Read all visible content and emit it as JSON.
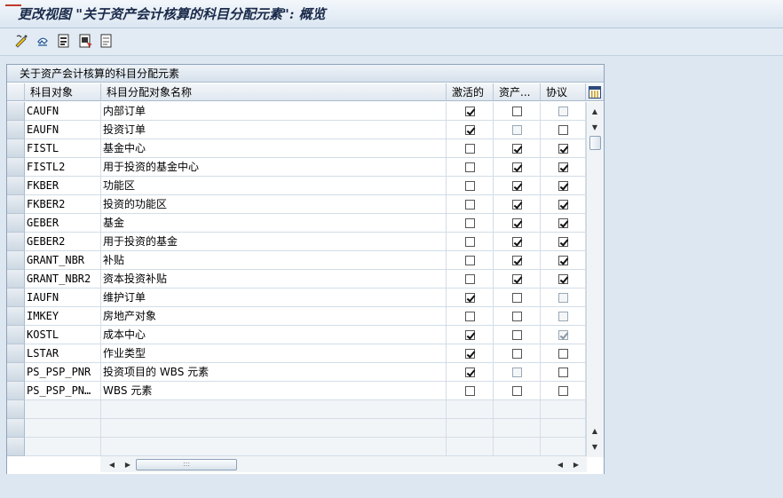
{
  "window": {
    "title": "更改视图 \"关于资产会计核算的科目分配元素\": 概览"
  },
  "toolbar": {
    "buttons": [
      {
        "name": "change-display-icon",
        "tooltip": ""
      },
      {
        "name": "undo-icon",
        "tooltip": ""
      },
      {
        "name": "select-all-icon",
        "tooltip": ""
      },
      {
        "name": "select-block-icon",
        "tooltip": ""
      },
      {
        "name": "deselect-all-icon",
        "tooltip": ""
      }
    ]
  },
  "table": {
    "title": "关于资产会计核算的科目分配元素",
    "columns": [
      "科目对象",
      "科目分配对象名称",
      "激活的",
      "资产...",
      "协议"
    ],
    "rows": [
      {
        "obj": "CAUFN",
        "name": "内部订单",
        "active": true,
        "asset": false,
        "agree": false,
        "agree_disabled": true,
        "asset_disabled": false
      },
      {
        "obj": "EAUFN",
        "name": "投资订单",
        "active": true,
        "asset": false,
        "agree": false,
        "agree_disabled": false,
        "asset_disabled": true
      },
      {
        "obj": "FISTL",
        "name": "基金中心",
        "active": false,
        "asset": true,
        "agree": true,
        "agree_disabled": false,
        "asset_disabled": false
      },
      {
        "obj": "FISTL2",
        "name": "用于投资的基金中心",
        "active": false,
        "asset": true,
        "agree": true,
        "agree_disabled": false,
        "asset_disabled": false
      },
      {
        "obj": "FKBER",
        "name": "功能区",
        "active": false,
        "asset": true,
        "agree": true,
        "agree_disabled": false,
        "asset_disabled": false
      },
      {
        "obj": "FKBER2",
        "name": "投资的功能区",
        "active": false,
        "asset": true,
        "agree": true,
        "agree_disabled": false,
        "asset_disabled": false
      },
      {
        "obj": "GEBER",
        "name": "基金",
        "active": false,
        "asset": true,
        "agree": true,
        "agree_disabled": false,
        "asset_disabled": false
      },
      {
        "obj": "GEBER2",
        "name": "用于投资的基金",
        "active": false,
        "asset": true,
        "agree": true,
        "agree_disabled": false,
        "asset_disabled": false
      },
      {
        "obj": "GRANT_NBR",
        "name": "补贴",
        "active": false,
        "asset": true,
        "agree": true,
        "agree_disabled": false,
        "asset_disabled": false
      },
      {
        "obj": "GRANT_NBR2",
        "name": "资本投资补贴",
        "active": false,
        "asset": true,
        "agree": true,
        "agree_disabled": false,
        "asset_disabled": false
      },
      {
        "obj": "IAUFN",
        "name": "维护订单",
        "active": true,
        "asset": false,
        "agree": false,
        "agree_disabled": true,
        "asset_disabled": false
      },
      {
        "obj": "IMKEY",
        "name": "房地产对象",
        "active": false,
        "asset": false,
        "agree": false,
        "agree_disabled": true,
        "asset_disabled": false
      },
      {
        "obj": "KOSTL",
        "name": "成本中心",
        "active": true,
        "asset": false,
        "agree": true,
        "agree_disabled": true,
        "asset_disabled": false
      },
      {
        "obj": "LSTAR",
        "name": "作业类型",
        "active": true,
        "asset": false,
        "agree": false,
        "agree_disabled": false,
        "asset_disabled": false
      },
      {
        "obj": "PS_PSP_PNR",
        "name": "投资项目的 WBS 元素",
        "active": true,
        "asset": false,
        "agree": false,
        "agree_disabled": false,
        "asset_disabled": true
      },
      {
        "obj": "PS_PSP_PN…",
        "name": "WBS 元素",
        "active": false,
        "asset": false,
        "agree": false,
        "agree_disabled": false,
        "asset_disabled": false
      }
    ],
    "empty_rows": 3
  },
  "scrollbar": {
    "h_thumb_grip": ":::"
  },
  "colors": {
    "background": "#dde7f1",
    "header": "#dfe7ef",
    "border": "#8da2b8"
  }
}
